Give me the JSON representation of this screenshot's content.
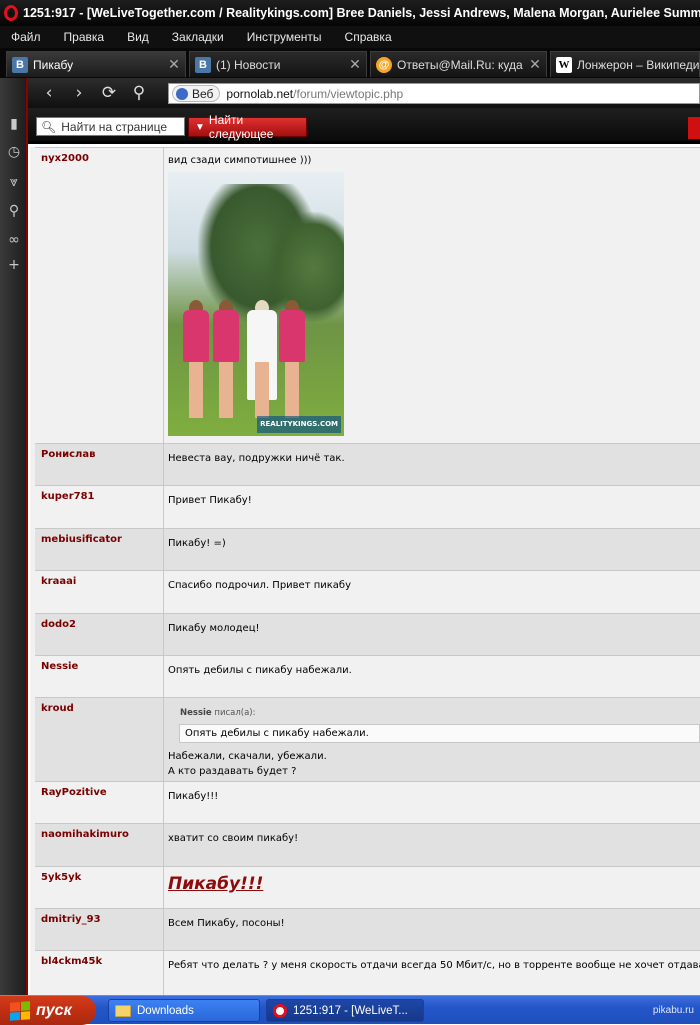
{
  "window": {
    "title": "1251:917 - [WeLiveTogether.com / Realitykings.com] Bree Daniels, Jessi Andrews, Malena Morgan, Aurielee Summers Thierry"
  },
  "menu": [
    "Файл",
    "Правка",
    "Вид",
    "Закладки",
    "Инструменты",
    "Справка"
  ],
  "tabs": [
    {
      "label": "Пикабу",
      "favicon": "vk-icon",
      "close": "✕"
    },
    {
      "label": "(1) Новости",
      "favicon": "vk-icon",
      "close": "✕"
    },
    {
      "label": "Ответы@Mail.Ru: куда ...",
      "favicon": "mail-icon",
      "close": "✕"
    },
    {
      "label": "Лонжерон – Википедия",
      "favicon": "wiki-icon",
      "close": ""
    }
  ],
  "address": {
    "badge": "Веб",
    "host": "pornolab.net",
    "path": "/forum/viewtopic.php"
  },
  "findbar": {
    "placeholder": "Найти на странице",
    "next_label": "Найти следующее"
  },
  "posts": [
    {
      "author": "nyx2000",
      "text": "вид сзади симпотишнее )))",
      "has_image": true,
      "image_brand": "REALITYKINGS.COM"
    },
    {
      "author": "Ронислав",
      "text": "Невеста вау, подружки ничё так."
    },
    {
      "author": "kuper781",
      "text": "Привет Пикабу!"
    },
    {
      "author": "mebiusificator",
      "text": "Пикабу! =)"
    },
    {
      "author": "kraaai",
      "text": "Спасибо подрочил. Привет пикабу"
    },
    {
      "author": "dodo2",
      "text": "Пикабу молодец!"
    },
    {
      "author": "Nessie",
      "text": "Опять дебилы с пикабу набежали."
    },
    {
      "author": "kroud",
      "quote_author": "Nessie",
      "quote_suffix": "писал(а):",
      "quote_text": "Опять дебилы с пикабу набежали.",
      "line1": "Набежали, скачали, убежали.",
      "line2": "А кто раздавать будет ?"
    },
    {
      "author": "RayPozitive",
      "text": "Пикабу!!!"
    },
    {
      "author": "naomihakimuro",
      "text": "хватит со своим пикабу!"
    },
    {
      "author": "5yk5yk",
      "text": "Пикабу!!!"
    },
    {
      "author": "dmitriy_93",
      "text": "Всем Пикабу, посоны!"
    },
    {
      "author": "bl4ckm45k",
      "text": "Ребят что делать ? у меня скорость отдачи всегда 50 Мбит/с, но в торренте вообще не хочет отдавать"
    }
  ],
  "taskbar": {
    "start": "пуск",
    "items": [
      "Downloads",
      "1251:917 - [WeLiveT..."
    ],
    "watermark": "pikabu.ru"
  }
}
